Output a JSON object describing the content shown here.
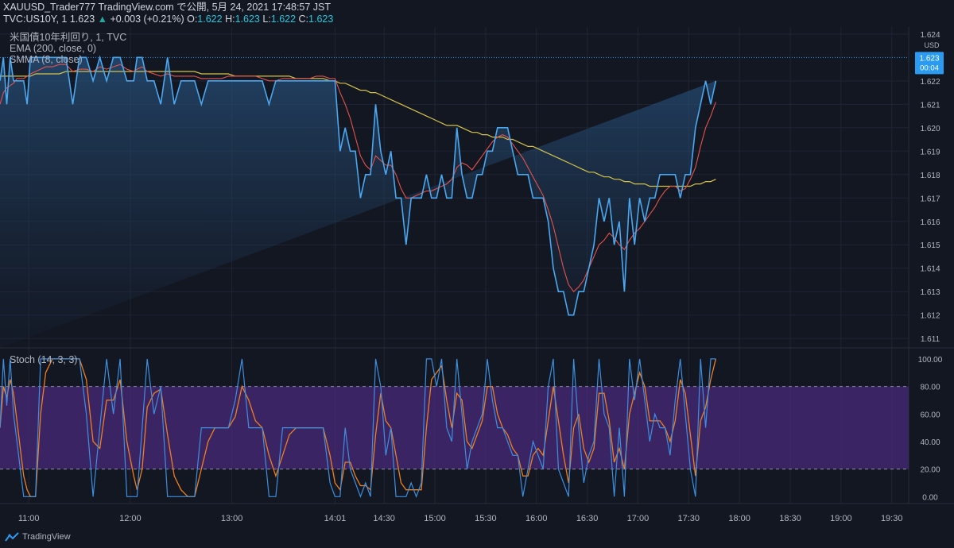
{
  "header": {
    "line1": "XAUUSD_Trader777 TradingView.com で公開, 5月 24, 2021 17:48:57 JST",
    "symbol": "TVC:US10Y, 1",
    "last": "1.623",
    "change": "+0.003 (+0.21%)",
    "o_label": "O:",
    "o": "1.622",
    "h_label": "H:",
    "h": "1.623",
    "l_label": "L:",
    "l": "1.622",
    "c_label": "C:",
    "c": "1.623"
  },
  "legend": {
    "main": "米国債10年利回り, 1, TVC",
    "ema": "EMA (200, close, 0)",
    "smma": "SMMA (8, close)",
    "stoch": "Stoch (14, 3, 3)"
  },
  "footer": {
    "brand": "TradingView"
  },
  "colors": {
    "background": "#131722",
    "price_line": "#4aa8f0",
    "smma": "#e5534b",
    "ema": "#d4c24a",
    "stoch_k": "#3d8fe0",
    "stoch_d": "#f07f1d",
    "stoch_band": "#4a2a7a",
    "price_label_bg": "#2a9bf0"
  },
  "chart_data": [
    {
      "type": "line",
      "title": "米国債10年利回り, 1, TVC",
      "currency": "USD",
      "x": [
        "10:43",
        "10:45",
        "10:47",
        "10:49",
        "10:51",
        "10:53",
        "10:55",
        "10:57",
        "10:59",
        "11:01",
        "11:04",
        "11:07",
        "11:10",
        "11:14",
        "11:18",
        "11:22",
        "11:26",
        "11:30",
        "11:34",
        "11:38",
        "11:42",
        "11:46",
        "11:50",
        "11:54",
        "11:58",
        "12:02",
        "12:04",
        "12:07",
        "12:10",
        "12:14",
        "12:18",
        "12:22",
        "12:26",
        "12:30",
        "12:34",
        "12:38",
        "12:42",
        "12:46",
        "12:50",
        "12:54",
        "12:58",
        "13:02",
        "13:06",
        "13:10",
        "13:14",
        "13:18",
        "13:22",
        "13:26",
        "13:30",
        "13:34",
        "13:38",
        "13:42",
        "13:46",
        "13:50",
        "13:54",
        "13:58",
        "14:01",
        "14:04",
        "14:07",
        "14:10",
        "14:13",
        "14:16",
        "14:19",
        "14:22",
        "14:25",
        "14:28",
        "14:31",
        "14:34",
        "14:37",
        "14:40",
        "14:43",
        "14:46",
        "14:49",
        "14:52",
        "14:55",
        "14:58",
        "15:01",
        "15:04",
        "15:07",
        "15:10",
        "15:13",
        "15:16",
        "15:19",
        "15:22",
        "15:25",
        "15:28",
        "15:31",
        "15:34",
        "15:37",
        "15:40",
        "15:43",
        "15:46",
        "15:49",
        "15:52",
        "15:55",
        "15:58",
        "16:01",
        "16:04",
        "16:07",
        "16:10",
        "16:13",
        "16:16",
        "16:19",
        "16:22",
        "16:25",
        "16:28",
        "16:31",
        "16:34",
        "16:37",
        "16:40",
        "16:43",
        "16:46",
        "16:49",
        "16:52",
        "16:55",
        "16:58",
        "17:01",
        "17:04",
        "17:07",
        "17:10",
        "17:13",
        "17:16",
        "17:19",
        "17:22",
        "17:25",
        "17:28",
        "17:31",
        "17:34",
        "17:37",
        "17:40",
        "17:43",
        "17:46"
      ],
      "series": [
        {
          "values": [
            1.622,
            1.623,
            1.621,
            1.623,
            1.622,
            1.622,
            1.622,
            1.622,
            1.621,
            1.623,
            1.623,
            1.623,
            1.623,
            1.623,
            1.623,
            1.623,
            1.621,
            1.623,
            1.623,
            1.622,
            1.623,
            1.622,
            1.623,
            1.623,
            1.622,
            1.622,
            1.623,
            1.623,
            1.622,
            1.622,
            1.621,
            1.623,
            1.621,
            1.622,
            1.622,
            1.622,
            1.621,
            1.622,
            1.622,
            1.622,
            1.622,
            1.622,
            1.622,
            1.622,
            1.622,
            1.622,
            1.621,
            1.622,
            1.622,
            1.622,
            1.622,
            1.622,
            1.622,
            1.622,
            1.622,
            1.622,
            1.622,
            1.619,
            1.62,
            1.619,
            1.619,
            1.617,
            1.618,
            1.618,
            1.621,
            1.619,
            1.618,
            1.619,
            1.617,
            1.617,
            1.615,
            1.617,
            1.617,
            1.617,
            1.618,
            1.617,
            1.617,
            1.618,
            1.617,
            1.617,
            1.62,
            1.618,
            1.617,
            1.617,
            1.618,
            1.618,
            1.619,
            1.619,
            1.62,
            1.62,
            1.62,
            1.619,
            1.618,
            1.618,
            1.618,
            1.617,
            1.617,
            1.617,
            1.616,
            1.614,
            1.613,
            1.613,
            1.612,
            1.612,
            1.613,
            1.613,
            1.614,
            1.615,
            1.617,
            1.616,
            1.617,
            1.615,
            1.616,
            1.613,
            1.617,
            1.615,
            1.617,
            1.616,
            1.617,
            1.617,
            1.618,
            1.618,
            1.618,
            1.618,
            1.617,
            1.618,
            1.618,
            1.62,
            1.621,
            1.622,
            1.621,
            1.622,
            1.622,
            1.623
          ]
        },
        {
          "name": "SMMA (8, close)",
          "values": [
            1.621,
            1.6215,
            1.6217,
            1.6218,
            1.6219,
            1.6221,
            1.6221,
            1.6221,
            1.6222,
            1.6223,
            1.6224,
            1.6225,
            1.6226,
            1.6226,
            1.6227,
            1.6227,
            1.6224,
            1.6225,
            1.6225,
            1.6224,
            1.6226,
            1.6225,
            1.6226,
            1.6227,
            1.6225,
            1.6224,
            1.6225,
            1.6226,
            1.6224,
            1.6223,
            1.6222,
            1.6223,
            1.6222,
            1.6222,
            1.6222,
            1.6222,
            1.6221,
            1.6221,
            1.6221,
            1.6221,
            1.6222,
            1.6222,
            1.6222,
            1.6222,
            1.6222,
            1.6221,
            1.622,
            1.622,
            1.6221,
            1.6221,
            1.6221,
            1.6221,
            1.6221,
            1.6222,
            1.6222,
            1.6221,
            1.6221,
            1.6215,
            1.621,
            1.6204,
            1.6196,
            1.6188,
            1.6184,
            1.6182,
            1.6188,
            1.6186,
            1.6184,
            1.6184,
            1.618,
            1.6174,
            1.617,
            1.617,
            1.6171,
            1.6172,
            1.6173,
            1.6173,
            1.6174,
            1.6175,
            1.6176,
            1.6178,
            1.6183,
            1.6185,
            1.6184,
            1.6182,
            1.6185,
            1.6188,
            1.6191,
            1.6194,
            1.6196,
            1.6197,
            1.6196,
            1.6193,
            1.619,
            1.6187,
            1.6183,
            1.6179,
            1.6175,
            1.6171,
            1.6165,
            1.6158,
            1.6149,
            1.614,
            1.6133,
            1.613,
            1.6132,
            1.6135,
            1.614,
            1.6145,
            1.615,
            1.6152,
            1.6155,
            1.6153,
            1.615,
            1.6148,
            1.6152,
            1.6155,
            1.6157,
            1.616,
            1.6163,
            1.6166,
            1.617,
            1.6173,
            1.6175,
            1.6175,
            1.6173,
            1.6174,
            1.6178,
            1.6183,
            1.6192,
            1.62,
            1.6205,
            1.6211,
            1.6214,
            1.6219
          ]
        },
        {
          "name": "EMA (200, close, 0)",
          "values": [
            1.6222,
            1.6222,
            1.6222,
            1.6222,
            1.6222,
            1.6222,
            1.6222,
            1.6222,
            1.6222,
            1.6222,
            1.6223,
            1.6223,
            1.6223,
            1.6223,
            1.6223,
            1.6224,
            1.6224,
            1.6224,
            1.6224,
            1.6224,
            1.6224,
            1.6224,
            1.6224,
            1.6224,
            1.6224,
            1.6224,
            1.6224,
            1.6224,
            1.6224,
            1.6224,
            1.6224,
            1.6224,
            1.6224,
            1.6224,
            1.6224,
            1.6224,
            1.6223,
            1.6223,
            1.6223,
            1.6223,
            1.6223,
            1.6222,
            1.6222,
            1.6222,
            1.6222,
            1.6222,
            1.6222,
            1.6222,
            1.6222,
            1.6222,
            1.6221,
            1.6221,
            1.6221,
            1.6221,
            1.6221,
            1.622,
            1.622,
            1.6219,
            1.6219,
            1.6218,
            1.6217,
            1.6216,
            1.6216,
            1.6215,
            1.6215,
            1.6214,
            1.6213,
            1.6212,
            1.6211,
            1.621,
            1.6209,
            1.6208,
            1.6207,
            1.6206,
            1.6205,
            1.6204,
            1.6203,
            1.6202,
            1.6201,
            1.6201,
            1.6201,
            1.62,
            1.6199,
            1.6198,
            1.6198,
            1.6197,
            1.6197,
            1.6196,
            1.6196,
            1.6196,
            1.6195,
            1.6195,
            1.6194,
            1.6193,
            1.6192,
            1.6192,
            1.6191,
            1.619,
            1.6189,
            1.6188,
            1.6187,
            1.6186,
            1.6185,
            1.6184,
            1.6183,
            1.6182,
            1.6181,
            1.6181,
            1.618,
            1.6179,
            1.6179,
            1.6178,
            1.6178,
            1.6177,
            1.6177,
            1.6176,
            1.6176,
            1.6176,
            1.6175,
            1.6175,
            1.6175,
            1.6175,
            1.6175,
            1.6175,
            1.6175,
            1.6175,
            1.6175,
            1.6176,
            1.6176,
            1.6177,
            1.6177,
            1.6178,
            1.6179,
            1.618
          ]
        }
      ],
      "last_label": {
        "value": "1.623",
        "countdown": "00:04"
      },
      "y_ticks": [
        1.611,
        1.612,
        1.613,
        1.614,
        1.615,
        1.616,
        1.617,
        1.618,
        1.619,
        1.62,
        1.621,
        1.622,
        1.624
      ],
      "ylim": [
        1.6106,
        1.6243
      ],
      "x_ticks": [
        "11:00",
        "12:00",
        "13:00",
        "14:01",
        "14:30",
        "15:00",
        "15:30",
        "16:00",
        "16:30",
        "17:00",
        "17:30",
        "18:00",
        "18:30",
        "19:00",
        "19:30"
      ],
      "xlim_minutes": [
        643,
        1180
      ]
    },
    {
      "type": "line",
      "title": "Stoch (14, 3, 3)",
      "x_minutes": [
        643,
        645,
        647,
        649,
        651,
        653,
        655,
        657,
        659,
        661,
        664,
        667,
        670,
        674,
        678,
        682,
        686,
        690,
        694,
        698,
        702,
        706,
        710,
        714,
        718,
        722,
        724,
        727,
        730,
        734,
        738,
        742,
        746,
        750,
        754,
        758,
        762,
        766,
        770,
        774,
        778,
        782,
        786,
        790,
        794,
        798,
        802,
        806,
        810,
        814,
        818,
        822,
        826,
        830,
        834,
        838,
        841,
        844,
        847,
        850,
        853,
        856,
        859,
        862,
        865,
        868,
        871,
        874,
        877,
        880,
        883,
        886,
        889,
        892,
        895,
        898,
        901,
        904,
        907,
        910,
        913,
        916,
        919,
        922,
        925,
        928,
        931,
        934,
        937,
        940,
        943,
        946,
        949,
        952,
        955,
        958,
        961,
        964,
        967,
        970,
        973,
        976,
        979,
        982,
        985,
        988,
        991,
        994,
        997,
        1000,
        1003,
        1006,
        1009,
        1012,
        1015,
        1018,
        1021,
        1024,
        1027,
        1030,
        1033,
        1036,
        1039,
        1042,
        1045,
        1048,
        1051,
        1054,
        1057,
        1060,
        1063,
        1066
      ],
      "series": [
        {
          "values": [
            50,
            100,
            66,
            100,
            60,
            40,
            20,
            0,
            0,
            0,
            0,
            100,
            100,
            100,
            100,
            100,
            100,
            100,
            60,
            0,
            50,
            100,
            60,
            100,
            0,
            0,
            0,
            50,
            100,
            60,
            80,
            0,
            0,
            0,
            0,
            0,
            50,
            50,
            50,
            50,
            50,
            70,
            100,
            50,
            50,
            50,
            0,
            0,
            50,
            50,
            50,
            50,
            50,
            50,
            50,
            10,
            0,
            0,
            50,
            20,
            10,
            0,
            10,
            0,
            100,
            80,
            30,
            50,
            0,
            0,
            0,
            10,
            0,
            10,
            100,
            100,
            80,
            100,
            50,
            40,
            100,
            60,
            20,
            40,
            50,
            60,
            100,
            70,
            50,
            50,
            40,
            30,
            30,
            0,
            20,
            40,
            30,
            20,
            80,
            100,
            20,
            10,
            0,
            100,
            50,
            10,
            30,
            40,
            100,
            60,
            50,
            0,
            50,
            0,
            100,
            70,
            100,
            70,
            40,
            60,
            50,
            50,
            30,
            70,
            100,
            60,
            20,
            0,
            100,
            50,
            100,
            100,
            100,
            100
          ]
        },
        {
          "values": [
            50,
            80,
            72,
            85,
            75,
            55,
            35,
            15,
            5,
            0,
            0,
            60,
            90,
            100,
            100,
            100,
            100,
            100,
            85,
            40,
            35,
            70,
            70,
            85,
            40,
            15,
            5,
            20,
            65,
            75,
            78,
            45,
            15,
            5,
            0,
            0,
            20,
            40,
            50,
            50,
            50,
            58,
            80,
            70,
            55,
            50,
            30,
            15,
            30,
            45,
            50,
            50,
            50,
            50,
            50,
            30,
            10,
            5,
            25,
            25,
            15,
            8,
            8,
            5,
            45,
            75,
            55,
            50,
            30,
            10,
            5,
            5,
            5,
            5,
            50,
            85,
            90,
            95,
            70,
            50,
            75,
            70,
            40,
            35,
            45,
            55,
            80,
            80,
            60,
            50,
            45,
            35,
            30,
            15,
            15,
            30,
            35,
            30,
            55,
            80,
            55,
            30,
            10,
            50,
            60,
            35,
            25,
            35,
            75,
            75,
            55,
            25,
            35,
            20,
            60,
            75,
            90,
            80,
            55,
            55,
            55,
            50,
            40,
            55,
            85,
            75,
            45,
            15,
            55,
            65,
            85,
            100,
            100,
            100
          ]
        }
      ],
      "y_ticks": [
        0,
        20,
        40,
        60,
        80,
        100
      ],
      "y_tick_labels": [
        "0.00",
        "20.00",
        "40.00",
        "60.00",
        "80.00",
        "100.00"
      ],
      "ylim": [
        -5,
        108
      ],
      "bands": [
        20,
        80
      ]
    }
  ]
}
